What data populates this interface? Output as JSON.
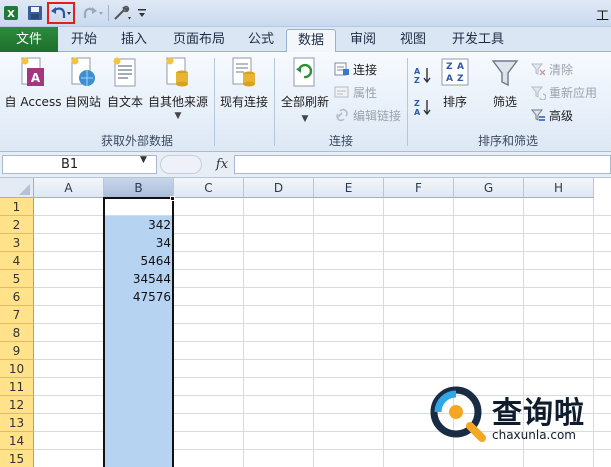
{
  "window": {
    "title_fragment": "工"
  },
  "quick_access": {
    "icons": [
      "excel-app-icon",
      "save-icon",
      "undo-icon",
      "redo-icon",
      "customize-icon",
      "more-icon"
    ]
  },
  "tabs": [
    {
      "id": "file",
      "label": "文件"
    },
    {
      "id": "home",
      "label": "开始"
    },
    {
      "id": "insert",
      "label": "插入"
    },
    {
      "id": "page-layout",
      "label": "页面布局"
    },
    {
      "id": "formulas",
      "label": "公式"
    },
    {
      "id": "data",
      "label": "数据",
      "active": true
    },
    {
      "id": "review",
      "label": "审阅"
    },
    {
      "id": "view",
      "label": "视图"
    },
    {
      "id": "developer",
      "label": "开发工具"
    }
  ],
  "ribbon": {
    "external_data": {
      "label": "获取外部数据",
      "buttons": [
        {
          "id": "access",
          "label": "自 Access"
        },
        {
          "id": "web",
          "label": "自网站"
        },
        {
          "id": "text",
          "label": "自文本"
        },
        {
          "id": "other",
          "label": "自其他来源"
        },
        {
          "id": "existing",
          "label": "现有连接"
        }
      ]
    },
    "connections": {
      "label": "连接",
      "refresh_all": "全部刷新",
      "connections": "连接",
      "properties": "属性",
      "edit_links": "编辑链接"
    },
    "sort_filter": {
      "label": "排序和筛选",
      "sort": "排序",
      "filter": "筛选",
      "clear": "清除",
      "reapply": "重新应用",
      "advanced": "高级"
    }
  },
  "formula_bar": {
    "name_box": "B1",
    "fx": "fx",
    "formula": ""
  },
  "sheet": {
    "columns": [
      "A",
      "B",
      "C",
      "D",
      "E",
      "F",
      "G",
      "H"
    ],
    "rows": [
      "1",
      "2",
      "3",
      "4",
      "5",
      "6",
      "7",
      "8",
      "9",
      "10",
      "11",
      "12",
      "13",
      "14",
      "15"
    ],
    "column_b_values": [
      "",
      "342",
      "34",
      "5464",
      "34544",
      "47576"
    ],
    "selected_column": "B"
  },
  "watermark": {
    "title": "查询啦",
    "url": "chaxunla.com"
  },
  "colors": {
    "file_tab": "#1d6f2c",
    "selection": "#b7d3f2",
    "row_header": "#ffe28a",
    "undo_highlight": "#e02020"
  }
}
